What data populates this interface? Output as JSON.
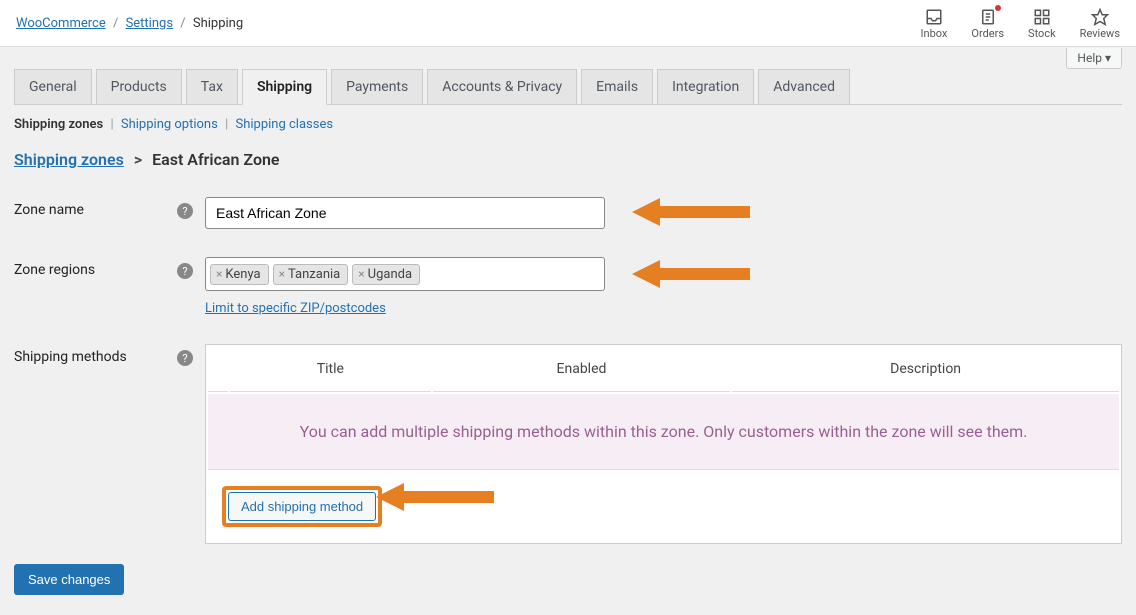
{
  "breadcrumb": {
    "a": "WooCommerce",
    "b": "Settings",
    "c": "Shipping"
  },
  "topbar": {
    "inbox": "Inbox",
    "orders": "Orders",
    "stock": "Stock",
    "reviews": "Reviews",
    "help": "Help"
  },
  "tabs": [
    "General",
    "Products",
    "Tax",
    "Shipping",
    "Payments",
    "Accounts & Privacy",
    "Emails",
    "Integration",
    "Advanced"
  ],
  "active_tab": "Shipping",
  "subnav": {
    "zones": "Shipping zones",
    "options": "Shipping options",
    "classes": "Shipping classes"
  },
  "heading": {
    "zones_link": "Shipping zones",
    "current": "East African Zone"
  },
  "form": {
    "name_label": "Zone name",
    "name_value": "East African Zone",
    "regions_label": "Zone regions",
    "regions": [
      "Kenya",
      "Tanzania",
      "Uganda"
    ],
    "zip_link": "Limit to specific ZIP/postcodes",
    "methods_label": "Shipping methods"
  },
  "methods_table": {
    "col_title": "Title",
    "col_enabled": "Enabled",
    "col_description": "Description",
    "hint": "You can add multiple shipping methods within this zone. Only customers within the zone will see them.",
    "add_btn": "Add shipping method"
  },
  "save_btn": "Save changes"
}
